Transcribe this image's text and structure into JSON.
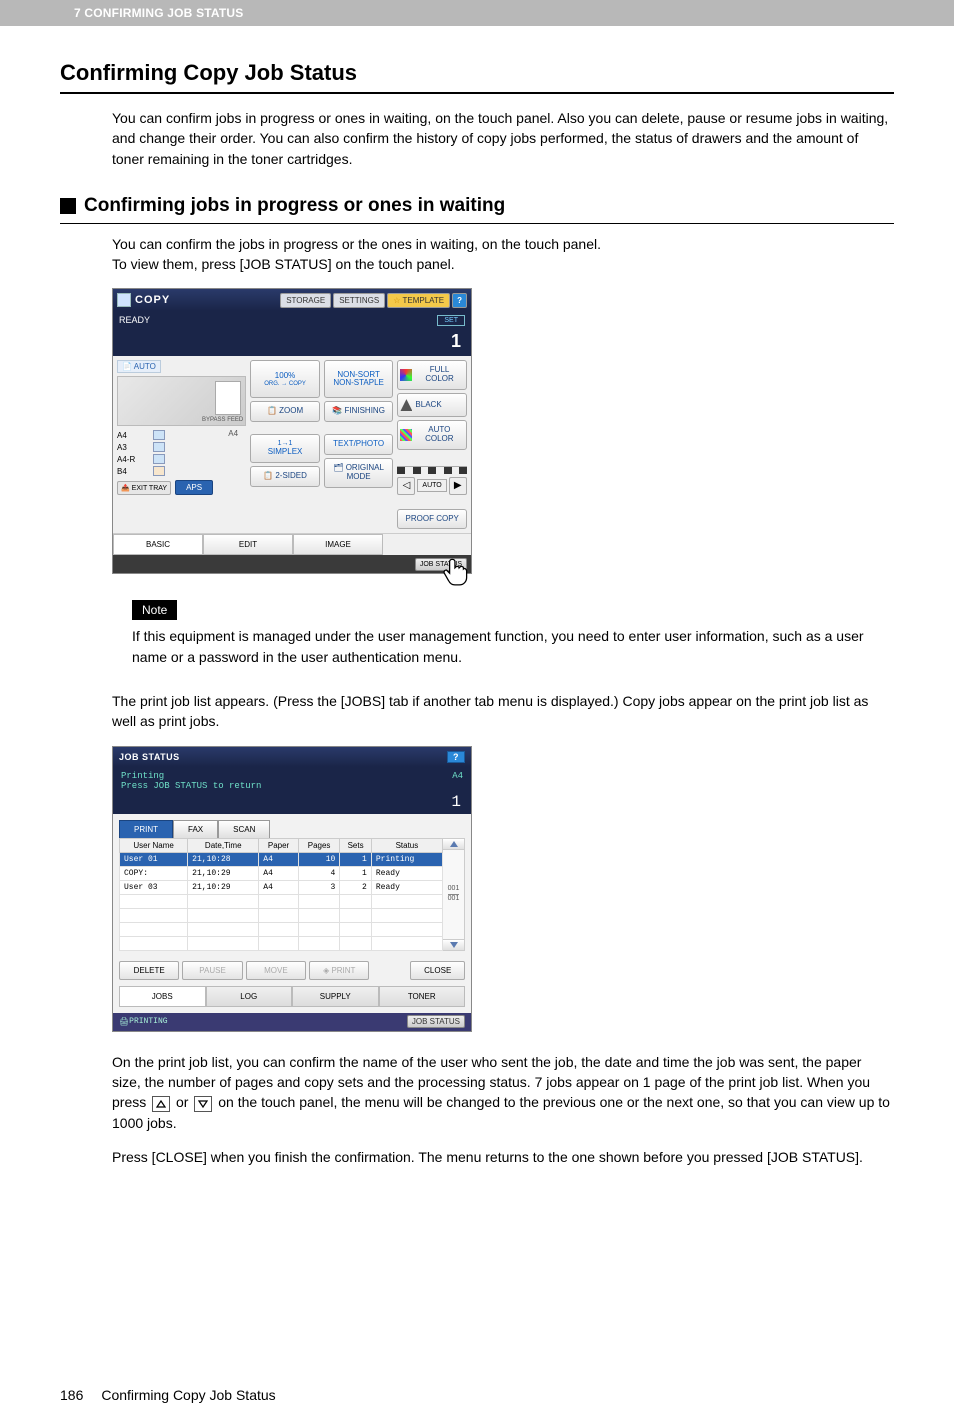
{
  "header_bar": "7 CONFIRMING JOB STATUS",
  "h1": "Confirming Copy Job Status",
  "intro": "You can confirm jobs in progress or ones in waiting, on the touch panel. Also you can delete, pause or resume jobs in waiting, and change their order. You can also confirm the history of copy jobs performed, the status of drawers and the amount of toner remaining in the toner cartridges.",
  "h2": "Confirming jobs in progress or ones in waiting",
  "p1a": "You can confirm the jobs in progress or the ones in waiting, on the touch panel.",
  "p1b": "To view them, press [JOB STATUS] on the touch panel.",
  "copy_panel": {
    "title": "COPY",
    "menu": {
      "storage": "STORAGE",
      "settings": "SETTINGS",
      "template": "TEMPLATE",
      "help": "?"
    },
    "ready": "READY",
    "set": "SET",
    "count": "1",
    "auto": "AUTO",
    "bypass": "BYPASS FEED",
    "trays": {
      "a4": "A4",
      "a3": "A3",
      "a4r": "A4-R",
      "b4": "B4",
      "a4side": "A4"
    },
    "exit": "EXIT TRAY",
    "aps": "APS",
    "zoom_pct": "100%",
    "zoom_sub": "ORG. → COPY",
    "zoom": "ZOOM",
    "simplex_top": "1→1",
    "simplex": "SIMPLEX",
    "twosided": "2-SIDED",
    "nonsort": "NON-SORT NON-STAPLE",
    "finishing": "FINISHING",
    "textphoto": "TEXT/PHOTO",
    "origmode": "ORIGINAL MODE",
    "fullcolor": "FULL COLOR",
    "black": "BLACK",
    "autocolor": "AUTO COLOR",
    "autodens": "AUTO",
    "proof": "PROOF COPY",
    "tabs": {
      "basic": "BASIC",
      "edit": "EDIT",
      "image": "IMAGE"
    },
    "jobstatus": "JOB STATUS"
  },
  "note_label": "Note",
  "note_text": "If this equipment is managed under the user management function, you need to enter user information, such as a user name or a password in the user authentication menu.",
  "p2": "The print job list appears. (Press the [JOBS] tab if another tab menu is displayed.) Copy jobs appear on the print job list as well as print jobs.",
  "job_panel": {
    "title": "JOB STATUS",
    "help": "?",
    "sub1": "Printing",
    "sub2": "Press JOB STATUS to return",
    "sub_paper": "A4",
    "sub_num": "1",
    "tabs": {
      "print": "PRINT",
      "fax": "FAX",
      "scan": "SCAN"
    },
    "cols": {
      "user": "User Name",
      "dt": "Date,Time",
      "paper": "Paper",
      "pages": "Pages",
      "sets": "Sets",
      "status": "Status"
    },
    "rows": [
      {
        "user": "User 01",
        "dt": "21,10:28",
        "paper": "A4",
        "pages": "10",
        "sets": "1",
        "status": "Printing"
      },
      {
        "user": "COPY:",
        "dt": "21,10:29",
        "paper": "A4",
        "pages": "4",
        "sets": "1",
        "status": "Ready"
      },
      {
        "user": "User 03",
        "dt": "21,10:29",
        "paper": "A4",
        "pages": "3",
        "sets": "2",
        "status": "Ready"
      }
    ],
    "page_ind": {
      "cur": "001",
      "tot": "001"
    },
    "actions": {
      "delete": "DELETE",
      "pause": "PAUSE",
      "move": "MOVE",
      "print": "PRINT",
      "close": "CLOSE"
    },
    "btabs": {
      "jobs": "JOBS",
      "log": "LOG",
      "supply": "SUPPLY",
      "toner": "TONER"
    },
    "footer_status": "PRINTING",
    "footer_btn": "JOB STATUS"
  },
  "p3a": "On the print job list, you can confirm the name of the user who sent the job, the date and time the job was sent, the paper size, the number of pages and copy sets and the processing status. 7 jobs appear on 1 page of the print job list. When you press ",
  "p3b": " or ",
  "p3c": " on the touch panel, the menu will be changed to the previous one or the next one, so that you can view up to 1000 jobs.",
  "p4": "Press [CLOSE] when you finish the confirmation. The menu returns to the one shown before you pressed [JOB STATUS].",
  "footer": {
    "page": "186",
    "title": "Confirming Copy Job Status"
  }
}
